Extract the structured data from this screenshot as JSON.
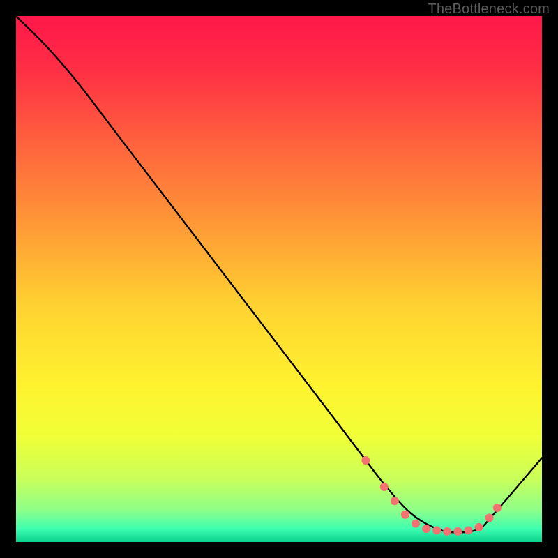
{
  "watermark": "TheBottleneck.com",
  "chart_data": {
    "type": "line",
    "title": "",
    "xlabel": "",
    "ylabel": "",
    "xlim": [
      0,
      100
    ],
    "ylim": [
      0,
      100
    ],
    "grid": false,
    "series": [
      {
        "name": "curve",
        "x": [
          0,
          6,
          12,
          20,
          30,
          40,
          50,
          60,
          66,
          70,
          75,
          80,
          84,
          88,
          91,
          100
        ],
        "y": [
          100,
          94,
          87,
          76.5,
          63.4,
          50.3,
          37.2,
          24.1,
          16.2,
          11,
          5.5,
          2.5,
          1.8,
          2.5,
          5.5,
          16
        ]
      }
    ],
    "markers": {
      "name": "dots",
      "color": "#f37171",
      "x": [
        66.5,
        70,
        72,
        74,
        76,
        78,
        80,
        82,
        84,
        86,
        88,
        90,
        91.5
      ],
      "y": [
        15.5,
        10.5,
        7.8,
        5.2,
        3.5,
        2.5,
        2.2,
        2.0,
        2.0,
        2.2,
        2.8,
        4.6,
        6.5
      ]
    },
    "background_gradient_stops": [
      {
        "offset": 0.0,
        "color": "#ff1749"
      },
      {
        "offset": 0.1,
        "color": "#ff2e45"
      },
      {
        "offset": 0.25,
        "color": "#ff653d"
      },
      {
        "offset": 0.4,
        "color": "#ff9a36"
      },
      {
        "offset": 0.55,
        "color": "#ffd231"
      },
      {
        "offset": 0.7,
        "color": "#fff22f"
      },
      {
        "offset": 0.8,
        "color": "#f0ff37"
      },
      {
        "offset": 0.88,
        "color": "#c9ff5a"
      },
      {
        "offset": 0.94,
        "color": "#8dff8a"
      },
      {
        "offset": 0.975,
        "color": "#3effb0"
      },
      {
        "offset": 1.0,
        "color": "#0ad18e"
      }
    ]
  }
}
